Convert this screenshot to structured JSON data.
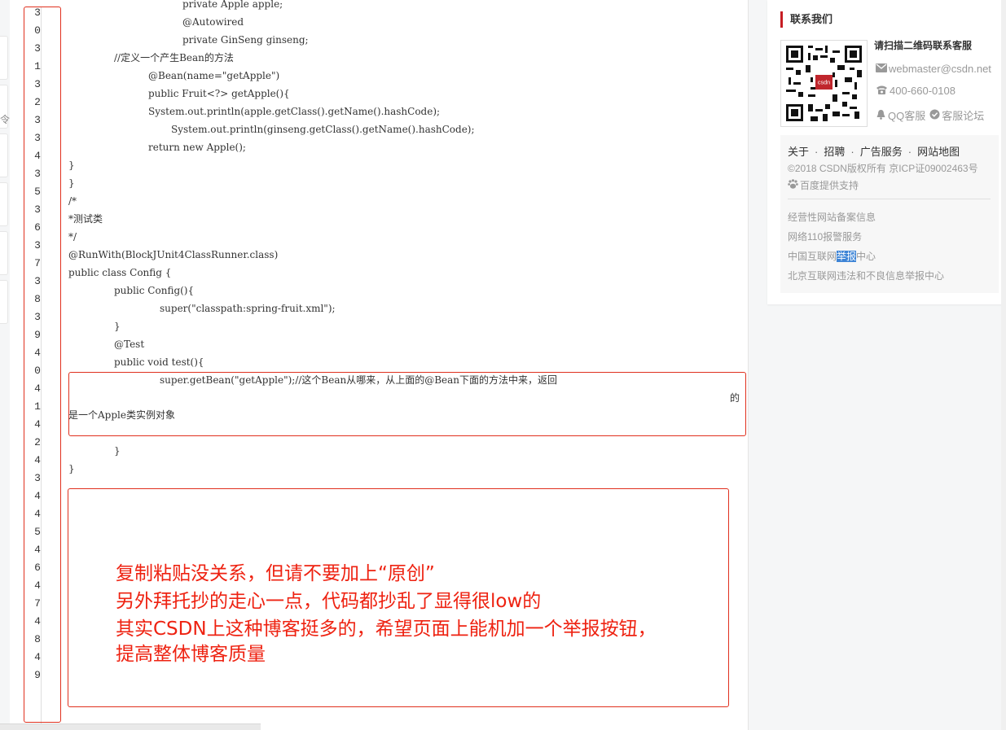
{
  "line_numbers": [
    "3",
    "0",
    "3",
    "1",
    "3",
    "2",
    "3",
    "3",
    "4",
    "3",
    "5",
    "3",
    "6",
    "3",
    "7",
    "3",
    "8",
    "3",
    "9",
    "4",
    "0",
    "4",
    "1",
    "4",
    "2",
    "4",
    "3",
    "4",
    "4",
    "5",
    "4",
    "6",
    "4",
    "7",
    "4",
    "8",
    "4",
    "9"
  ],
  "code_lines": [
    {
      "indent": 140,
      "text": "private Apple apple;"
    },
    {
      "indent": 140,
      "text": "@Autowired"
    },
    {
      "indent": 140,
      "text": "private GinSeng ginseng;"
    },
    {
      "indent": 56,
      "text": "//定义一个产生Bean的方法"
    },
    {
      "indent": 98,
      "text": "@Bean(name=\"getApple\")"
    },
    {
      "indent": 98,
      "text": "public Fruit<?> getApple(){"
    },
    {
      "indent": 98,
      "text": "System.out.println(apple.getClass().getName().hashCode);"
    },
    {
      "indent": 126,
      "text": "System.out.println(ginseng.getClass().getName().hashCode);"
    },
    {
      "indent": 98,
      "text": "return new Apple();"
    },
    {
      "indent": 0,
      "text": "}"
    },
    {
      "indent": 0,
      "text": "}"
    },
    {
      "indent": 0,
      "text": "/*"
    },
    {
      "indent": 0,
      "text": "*测试类"
    },
    {
      "indent": 0,
      "text": "*/"
    },
    {
      "indent": 0,
      "text": "@RunWith(BlockJUnit4ClassRunner.class)"
    },
    {
      "indent": 0,
      "text": "public class Config {"
    },
    {
      "indent": 56,
      "text": "public Config(){"
    },
    {
      "indent": 112,
      "text": "super(\"classpath:spring-fruit.xml\");"
    },
    {
      "indent": 56,
      "text": "}"
    },
    {
      "indent": 56,
      "text": "@Test"
    },
    {
      "indent": 56,
      "text": "public void test(){"
    },
    {
      "indent": 112,
      "text": "super.getBean(\"getApple\");//这个Bean从哪来，从上面的@Bean下面的方法中来，返回"
    }
  ],
  "wrapped_de": "的",
  "wrapped_tail": "是一个Apple类实例对象",
  "closing_1": "}",
  "closing_2": "}",
  "note_lines": [
    "复制粘贴没关系，但请不要加上“原创”",
    "另外拜托抄的走心一点，代码都抄乱了显得很low的",
    "其实CSDN上这种博客挺多的，希望页面上能机加一个举报按钮，",
    "提高整体博客质量"
  ],
  "sidebar": {
    "title": "联系我们",
    "contact_title": "请扫描二维码联系客服",
    "email": "webmaster@csdn.net",
    "phone": "400-660-0108",
    "qq": "QQ客服",
    "forum": "客服论坛",
    "links": [
      "关于",
      "招聘",
      "广告服务",
      "网站地图"
    ],
    "copyright": "©2018 CSDN版权所有 京ICP证09002463号",
    "baidu": "百度提供支持",
    "extra": {
      "beian": "经营性网站备案信息",
      "police": "网络110报警服务",
      "report_pre": "中国互联网",
      "report_sel": "举报",
      "report_post": "中心",
      "beijing": "北京互联网违法和不良信息举报中心"
    },
    "qr_logo": "csdn"
  },
  "left_glyph": "令",
  "colors": {
    "accent_red": "#e0301e",
    "note_red": "#ee2211",
    "selection_blue": "#3d84d6"
  }
}
